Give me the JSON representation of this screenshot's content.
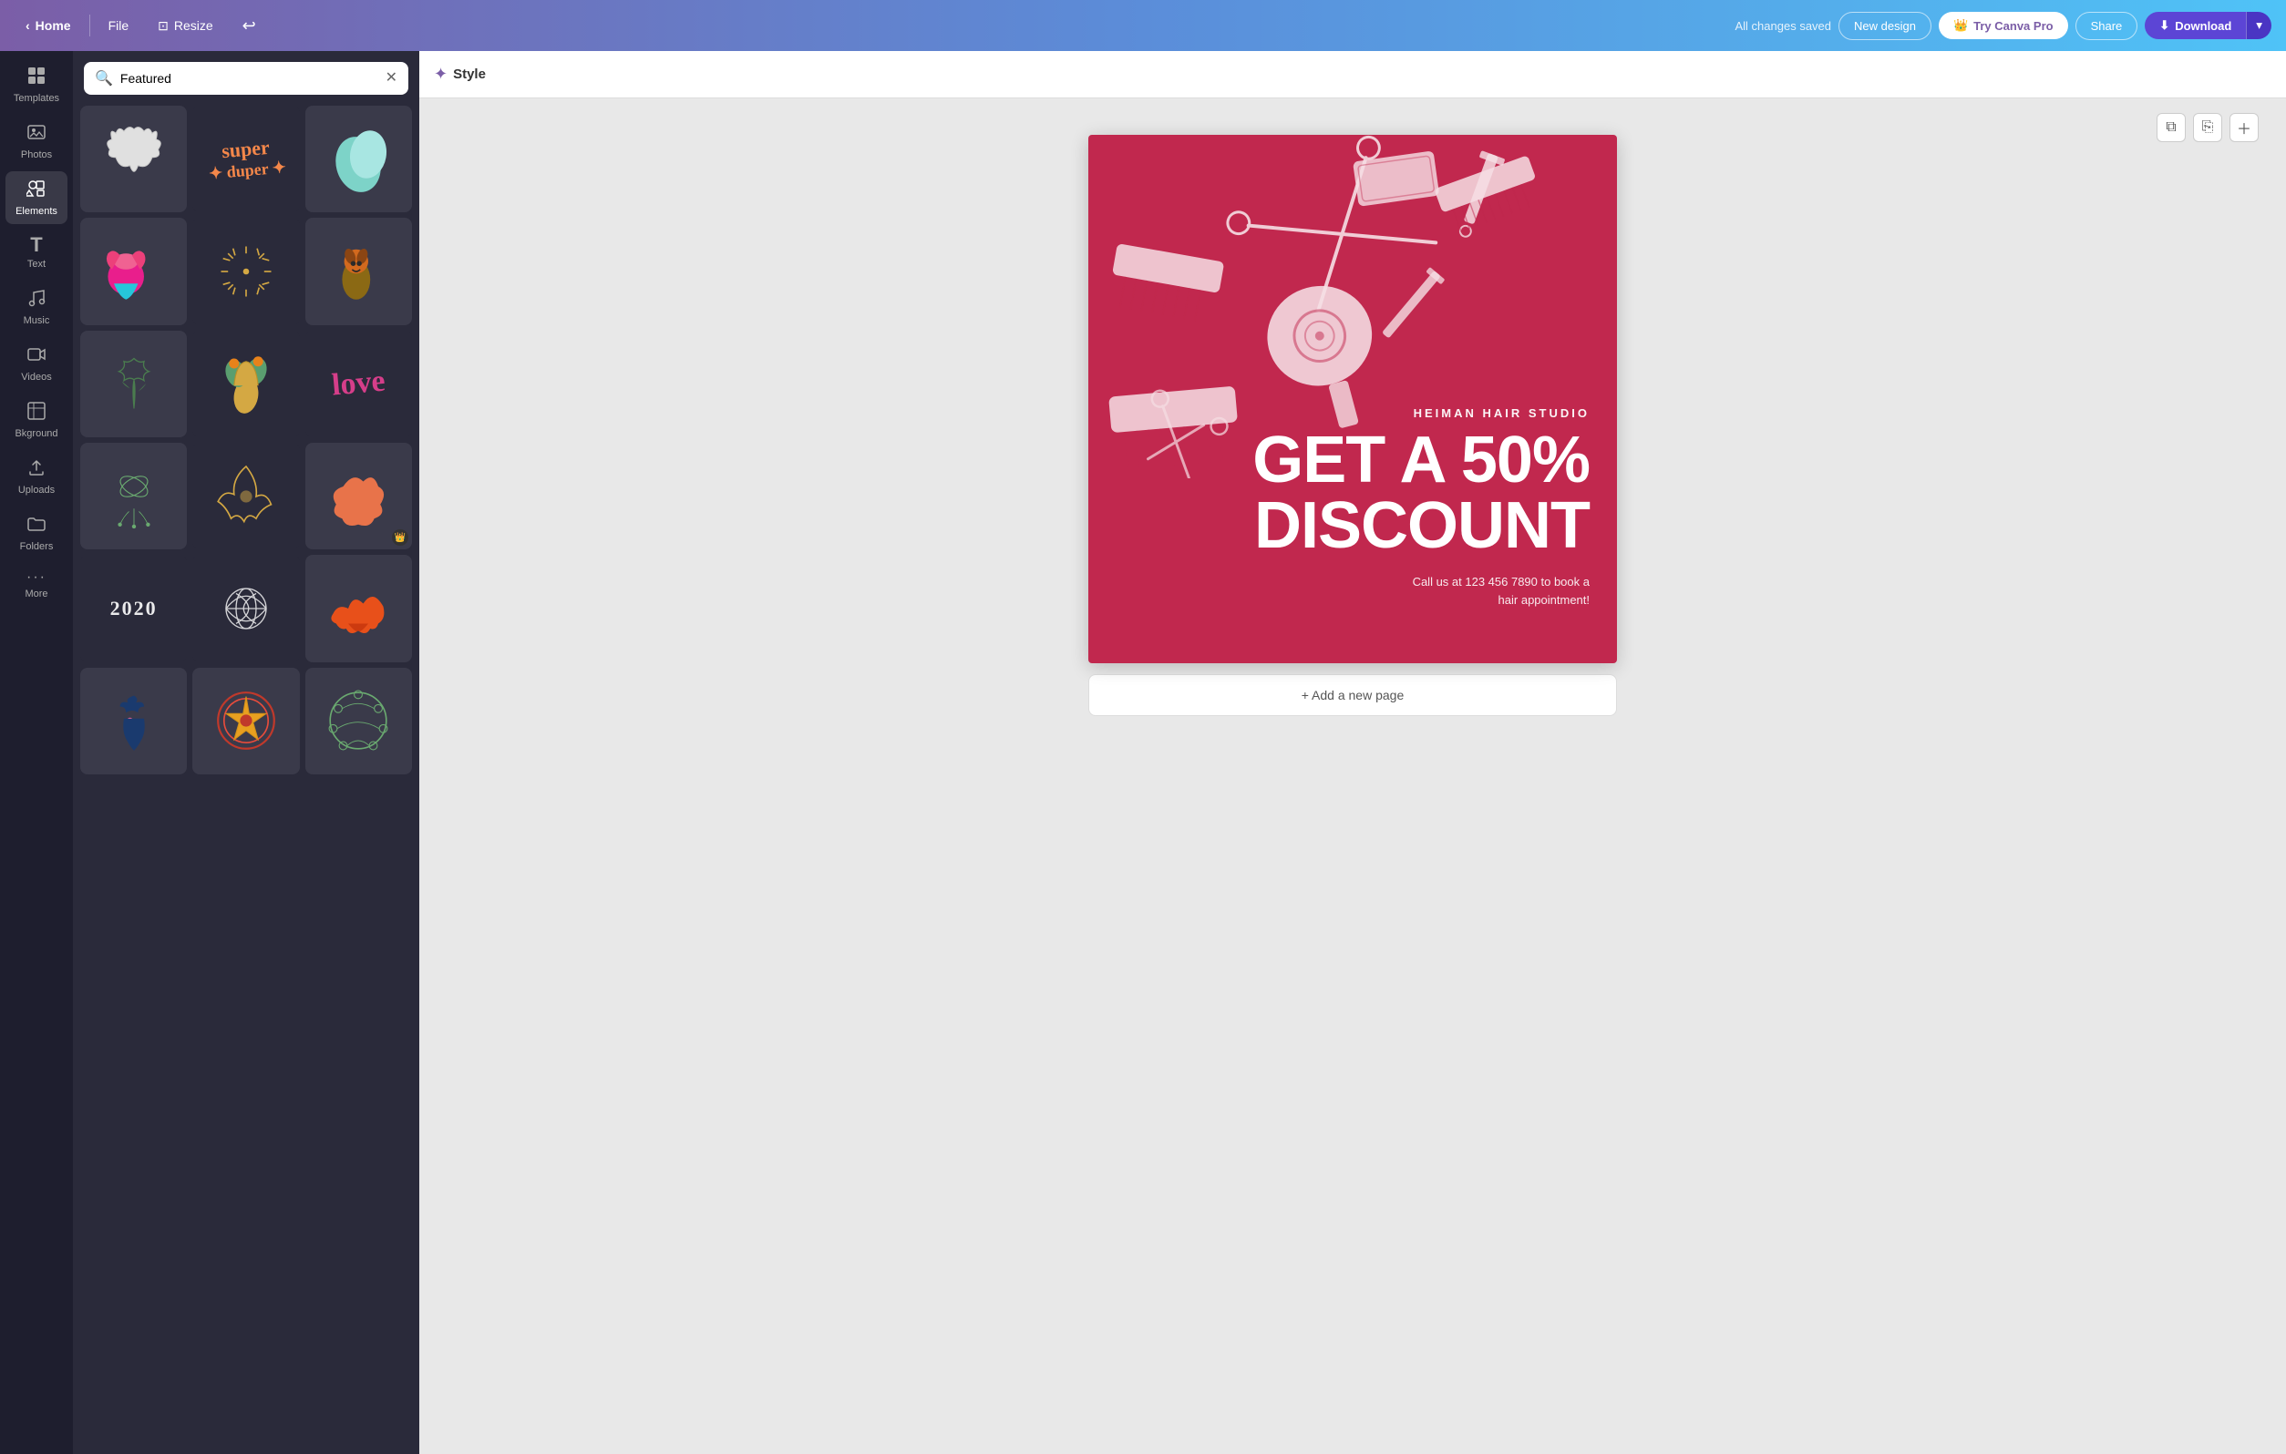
{
  "nav": {
    "home_label": "Home",
    "file_label": "File",
    "resize_label": "Resize",
    "undo_label": "↩",
    "saved_label": "All changes saved",
    "new_design_label": "New design",
    "try_pro_label": "Try Canva Pro",
    "share_label": "Share",
    "download_label": "Download"
  },
  "sidebar": {
    "items": [
      {
        "id": "templates",
        "label": "Templates",
        "icon": "⊞"
      },
      {
        "id": "photos",
        "label": "Photos",
        "icon": "🖼"
      },
      {
        "id": "elements",
        "label": "Elements",
        "icon": "◈"
      },
      {
        "id": "text",
        "label": "Text",
        "icon": "T"
      },
      {
        "id": "music",
        "label": "Music",
        "icon": "♪"
      },
      {
        "id": "videos",
        "label": "Videos",
        "icon": "▶"
      },
      {
        "id": "background",
        "label": "Bkground",
        "icon": "▦"
      },
      {
        "id": "uploads",
        "label": "Uploads",
        "icon": "↑"
      },
      {
        "id": "folders",
        "label": "Folders",
        "icon": "📁"
      },
      {
        "id": "more",
        "label": "More",
        "icon": "···"
      }
    ]
  },
  "panel": {
    "search_placeholder": "Featured",
    "search_value": "Featured"
  },
  "style_toolbar": {
    "style_label": "Style",
    "style_icon": "✦"
  },
  "canvas": {
    "studio_name": "HEIMAN HAIR STUDIO",
    "headline1": "GET A 50%",
    "headline2": "DISCOUNT",
    "contact": "Call us at 123 456 7890 to book a\nhair appointment!"
  },
  "add_page": {
    "label": "+ Add a new page"
  },
  "colors": {
    "card_bg": "#c1284e",
    "nav_grad_start": "#7b5ea7",
    "nav_grad_end": "#4fc3f7",
    "panel_bg": "#2a2a3a",
    "sidebar_bg": "#1e1e2e"
  }
}
